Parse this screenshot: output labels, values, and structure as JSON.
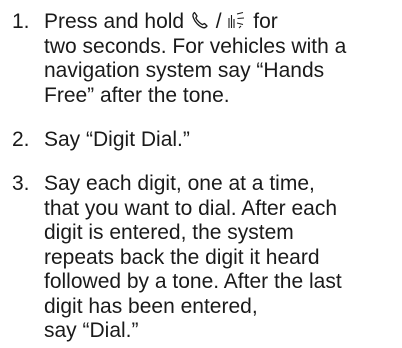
{
  "steps": [
    {
      "number": "1.",
      "lines": [
        {
          "before_icons": "Press and hold ",
          "icon_separator": " / ",
          "after_icons": " for"
        },
        {
          "text": "two seconds. For vehicles with a"
        },
        {
          "text": "navigation system say “Hands"
        },
        {
          "text": "Free” after the tone."
        }
      ],
      "icons": [
        "phone-handset-icon",
        "voice-recognition-icon"
      ]
    },
    {
      "number": "2.",
      "lines": [
        {
          "text": "Say “Digit Dial.”"
        }
      ]
    },
    {
      "number": "3.",
      "lines": [
        {
          "text": "Say each digit, one at a time,"
        },
        {
          "text": "that you want to dial. After each"
        },
        {
          "text": "digit is entered, the system"
        },
        {
          "text": "repeats back the digit it heard"
        },
        {
          "text": "followed by a tone. After the last"
        },
        {
          "text": "digit has been entered,"
        },
        {
          "text": "say “Dial.”"
        }
      ]
    }
  ]
}
